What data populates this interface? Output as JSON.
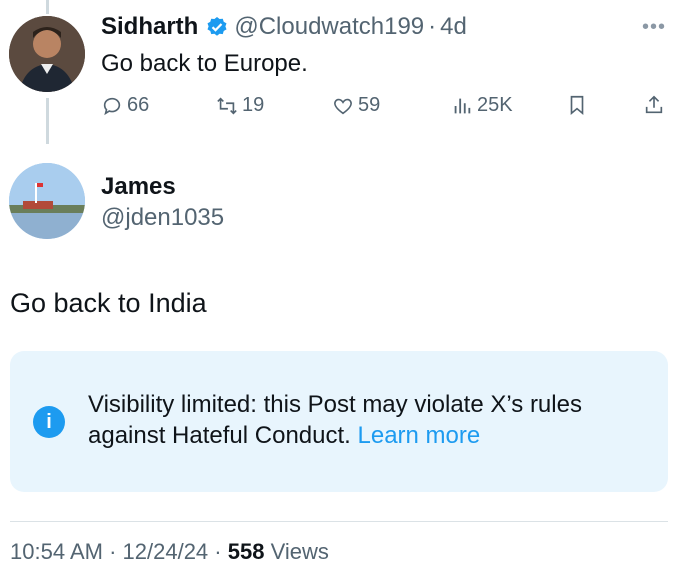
{
  "reply": {
    "name": "Sidharth",
    "handle": "@Cloudwatch199",
    "time": "4d",
    "text": "Go back to Europe.",
    "replies": "66",
    "reposts": "19",
    "likes": "59",
    "views": "25K"
  },
  "post": {
    "name": "James",
    "handle": "@jden1035",
    "text": "Go back to India",
    "notice_text": "Visibility limited: this Post may violate X’s rules against Hateful Conduct. ",
    "learn_more": "Learn more",
    "time": "10:54 AM",
    "date": "12/24/24",
    "views_count": "558",
    "views_label": "Views"
  },
  "icons": {
    "verified": "verified-badge-icon",
    "reply": "reply-icon",
    "repost": "repost-icon",
    "like": "heart-icon",
    "views": "analytics-icon",
    "bookmark": "bookmark-icon",
    "share": "share-icon",
    "info": "info-icon",
    "more": "more-icon"
  },
  "colors": {
    "accent": "#1d9bf0",
    "muted": "#536471",
    "notice_bg": "#e8f5fd"
  }
}
